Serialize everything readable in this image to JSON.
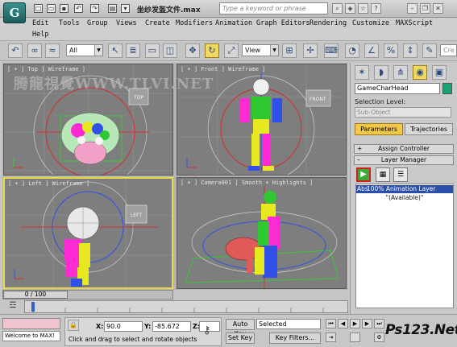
{
  "titlebar": {
    "app_logo": "G",
    "file_title": "坐纱发盔文件.max",
    "search_placeholder": "Type a keyword or phrase"
  },
  "menu": {
    "items": [
      "Edit",
      "Tools",
      "Group",
      "Views",
      "Create",
      "Modifiers",
      "Animation",
      "Graph Editors",
      "Rendering",
      "Customize",
      "MAXScript",
      "Help"
    ]
  },
  "toolbar": {
    "filter_value": "All",
    "ref_coord_value": "View",
    "create_selection_placeholder": "Cre"
  },
  "viewports": {
    "top_label": "[ + ] Top ] Wireframe ]",
    "front_label": "[ + ] Front ] Wireframe ]",
    "left_label": "[ + ] Left ] Wireframe ]",
    "camera_label": "[ + ] Camera001 ] Smooth + Highlights ]",
    "viewcube_top": "TOP",
    "viewcube_front": "FRONT",
    "viewcube_left": "LEFT",
    "watermark": "腾龍視覺WWW.TLVI.NET"
  },
  "command_panel": {
    "object_name": "GameCharHead",
    "object_color": "#1aa373",
    "selection_level_label": "Selection Level:",
    "sub_object_value": "Sub-Object",
    "parameters_tab": "Parameters",
    "trajectories_tab": "Trajectories",
    "assign_controller": "Assign Controller",
    "layer_manager": "Layer Manager",
    "layer_1_prefix": "Abs",
    "layer_1": "100% Animation Layer",
    "layer_2": "\"(Available)\""
  },
  "timeline": {
    "frame_display": "0 / 100"
  },
  "status": {
    "listener_text": "Welcome to MAX!",
    "x_label": "X:",
    "x_value": "90.0",
    "y_label": "Y:",
    "y_value": "-85.672",
    "z_label": "Z:",
    "z_value": "",
    "prompt": "Click and drag to select and rotate objects",
    "auto_key": "Auto Key",
    "set_key": "Set Key",
    "selected_value": "Selected",
    "key_filters": "Key Filters...",
    "brand": "Ps123.Net"
  }
}
